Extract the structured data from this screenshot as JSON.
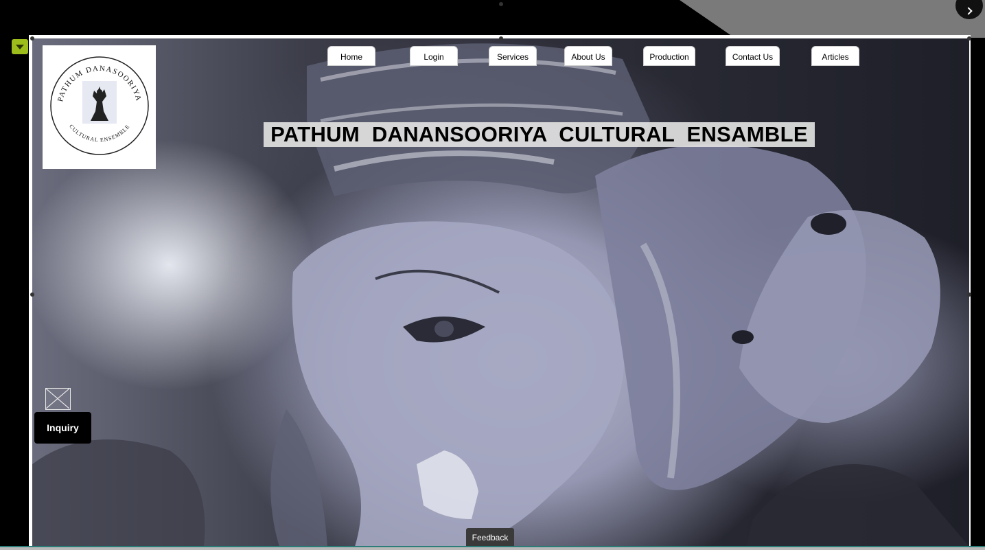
{
  "nav": {
    "items": [
      {
        "label": "Home"
      },
      {
        "label": "Login"
      },
      {
        "label": "Services"
      },
      {
        "label": "About Us"
      },
      {
        "label": "Production"
      },
      {
        "label": "Contact Us"
      },
      {
        "label": "Articles"
      }
    ]
  },
  "logo": {
    "text_top": "PATHUM DANASOORIYA",
    "text_bottom": "CULTURAL ENSEMBLE"
  },
  "hero": {
    "title": "PATHUM  DANANSOORIYA  CULTURAL  ENSAMBLE"
  },
  "inquiry": {
    "label": "Inquiry"
  },
  "feedback": {
    "label": "Feedback"
  },
  "icons": {
    "collapse": "chevron-down-icon",
    "next": "chevron-right-icon",
    "broken_image": "broken-image-icon"
  },
  "colors": {
    "toggle_accent": "#9dbd1c",
    "bottom_strip": "#2b7d78"
  }
}
